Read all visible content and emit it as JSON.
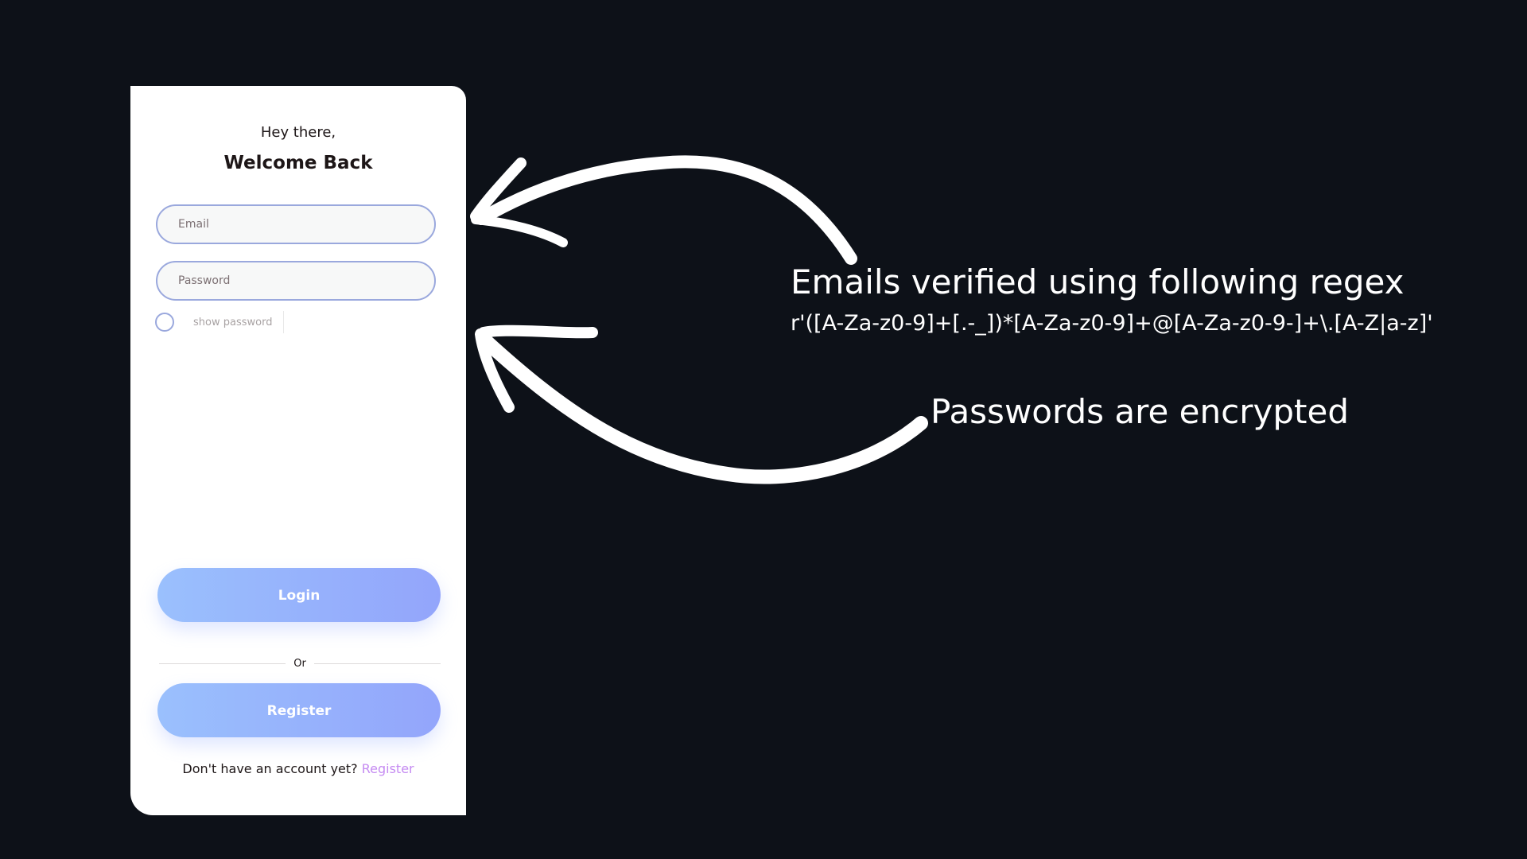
{
  "login_card": {
    "greeting": "Hey there,",
    "title": "Welcome Back",
    "email_placeholder": "Email",
    "password_placeholder": "Password",
    "show_password_label": "show password",
    "login_label": "Login",
    "or_label": "Or",
    "register_button_label": "Register",
    "footer_text": "Don't have an account yet? ",
    "footer_link": "Register"
  },
  "annotations": {
    "email_note": "Emails verified using following regex",
    "email_regex": "r'([A-Za-z0-9]+[.-_])*[A-Za-z0-9]+@[A-Za-z0-9-]+\\.[A-Z|a-z]'",
    "password_note": "Passwords are encrypted"
  },
  "colors": {
    "background": "#0d1118",
    "card": "#ffffff",
    "button_gradient_start": "#9ac0fd",
    "button_gradient_end": "#93a5fb",
    "field_border": "#9aa8dd",
    "link": "#c58bf2",
    "annotation_text": "#ffffff"
  }
}
